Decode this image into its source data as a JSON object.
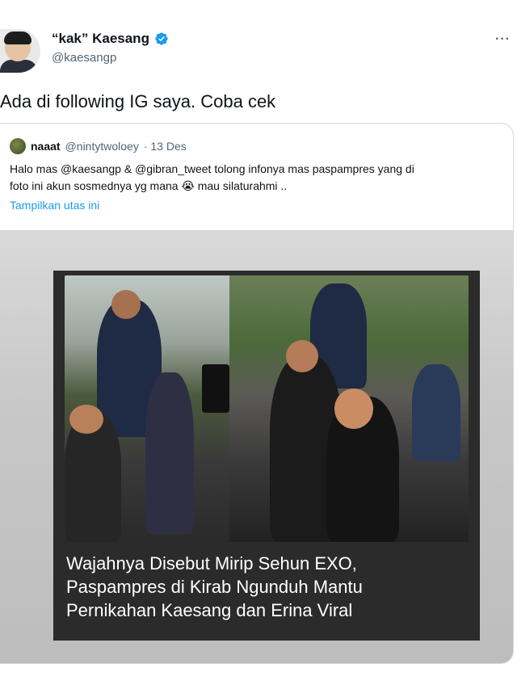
{
  "tweet": {
    "author_name": "“kak” Kaesang",
    "author_handle": "@kaesangp",
    "more_label": "···",
    "text": "Ada di following IG saya. Coba cek"
  },
  "quote": {
    "author_name": "naaat",
    "author_handle": "@nintytwoloey",
    "date": "· 13 Des",
    "body_line1": "Halo mas @kaesangp  & @gibran_tweet tolong infonya mas paspampres yang di",
    "body_line2_a": "foto ini akun sosmednya yg mana",
    "body_line2_b": "mau silaturahmi ..",
    "show_thread": "Tampilkan utas ini"
  },
  "media": {
    "headline_line1": "Wajahnya Disebut Mirip Sehun EXO,",
    "headline_line2": "Paspampres di Kirab Ngunduh Mantu",
    "headline_line3": "Pernikahan Kaesang dan Erina Viral"
  },
  "icons": {
    "verified": "verified-badge-icon",
    "more": "more-icon",
    "emoji": "crying-face-icon"
  },
  "colors": {
    "link": "#1d9bf0",
    "secondary_text": "#536471",
    "verified": "#1d9bf0"
  }
}
